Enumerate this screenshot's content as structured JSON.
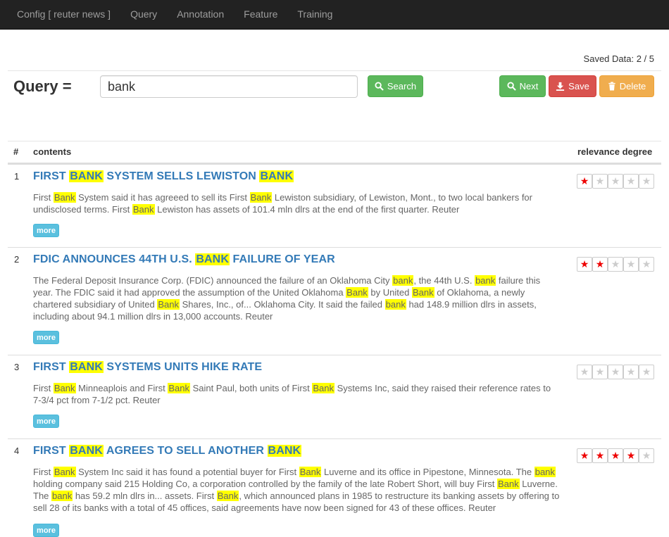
{
  "nav": {
    "items": [
      "Config [ reuter news ]",
      "Query",
      "Annotation",
      "Feature",
      "Training"
    ]
  },
  "saved_data": "Saved Data: 2 / 5",
  "query": {
    "label": "Query =",
    "value": "bank",
    "search_label": "Search",
    "next_label": "Next",
    "save_label": "Save",
    "delete_label": "Delete"
  },
  "table": {
    "col_num": "#",
    "col_contents": "contents",
    "col_relevance": "relevance degree",
    "rows": [
      {
        "num": "1",
        "title": "FIRST [[BANK]] SYSTEM SELLS LEWISTON [[BANK]]",
        "body": "First [[Bank]] System said it has agreeed to sell its First [[Bank]] Lewiston subsidiary, of Lewiston, Mont., to two local bankers for undisclosed terms. First [[Bank]] Lewiston has assets of 101.4 mln dlrs at the end of the first quarter. Reuter",
        "more": "more",
        "rating": 1
      },
      {
        "num": "2",
        "title": "FDIC ANNOUNCES 44TH U.S. [[BANK]] FAILURE OF YEAR",
        "body": "The Federal Deposit Insurance Corp. (FDIC) announced the failure of an Oklahoma City [[bank]], the 44th U.S. [[bank]] failure this year. The FDIC said it had approved the assumption of the United Oklahoma [[Bank]] by United [[Bank]] of Oklahoma, a newly chartered subsidiary of United [[Bank]] Shares, Inc., of... Oklahoma City. It said the failed [[bank]] had 148.9 million dlrs in assets, including about 94.1 million dlrs in 13,000 accounts. Reuter",
        "more": "more",
        "rating": 2
      },
      {
        "num": "3",
        "title": "FIRST [[BANK]] SYSTEMS UNITS HIKE RATE",
        "body": "First [[Bank]] Minneaplois and First [[Bank]] Saint Paul, both units of First [[Bank]] Systems Inc, said they raised their reference rates to 7-3/4 pct from 7-1/2 pct. Reuter",
        "more": "more",
        "rating": 0
      },
      {
        "num": "4",
        "title": "FIRST [[BANK]] AGREES TO SELL ANOTHER [[BANK]]",
        "body": "First [[Bank]] System Inc said it has found a potential buyer for First [[Bank]] Luverne and its office in Pipestone, Minnesota. The [[bank]] holding company said 215 Holding Co, a corporation controlled by the family of the late Robert Short, will buy First [[Bank]] Luverne. The [[bank]] has 59.2 mln dlrs in... assets. First [[Bank]], which announced plans in 1985 to restructure its banking assets by offering to sell 28 of its banks with a total of 45 offices, said agreements have now been signed for 43 of these offices. Reuter",
        "more": "more",
        "rating": 4
      }
    ]
  },
  "colors": {
    "navbar": "#222222",
    "title_link": "#337ab7",
    "highlight": "#ffff00",
    "star_on": "#ee0000"
  }
}
